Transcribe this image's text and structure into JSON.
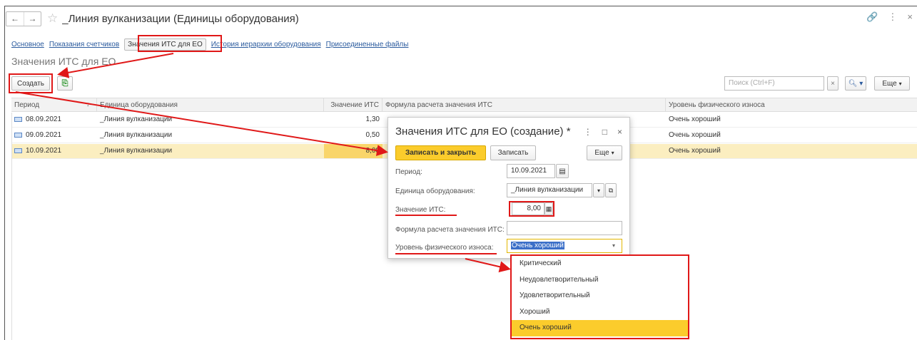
{
  "window": {
    "title": "_Линия вулканизации (Единицы оборудования)",
    "nav_back": "←",
    "nav_forward": "→"
  },
  "tabs": [
    {
      "label": "Основное"
    },
    {
      "label": "Показания счетчиков"
    },
    {
      "label": "Значения ИТС для ЕО",
      "active": true
    },
    {
      "label": "История иерархии оборудования"
    },
    {
      "label": "Присоединенные файлы"
    }
  ],
  "section_title": "Значения ИТС для ЕО",
  "toolbar": {
    "create_label": "Создать",
    "search_placeholder": "Поиск (Ctrl+F)",
    "more_label": "Еще"
  },
  "table": {
    "columns": [
      "Период",
      "Единица оборудования",
      "Значение ИТС",
      "Формула расчета значения ИТС",
      "Уровень физического износа"
    ],
    "rows": [
      {
        "period": "08.09.2021",
        "unit": "_Линия вулканизации",
        "value": "1,30",
        "formula": "",
        "wear": "Очень хороший"
      },
      {
        "period": "09.09.2021",
        "unit": "_Линия вулканизации",
        "value": "0,50",
        "formula": "",
        "wear": "Очень хороший"
      },
      {
        "period": "10.09.2021",
        "unit": "_Линия вулканизации",
        "value": "8,00",
        "formula": "",
        "wear": "Очень хороший",
        "selected": true
      }
    ]
  },
  "dialog": {
    "title": "Значения ИТС для ЕО (создание) *",
    "save_close_label": "Записать и закрыть",
    "save_label": "Записать",
    "more_label": "Еще",
    "fields": {
      "period_label": "Период:",
      "period_value": "10.09.2021",
      "unit_label": "Единица оборудования:",
      "unit_value": "_Линия вулканизации",
      "value_label": "Значение ИТС:",
      "value_value": "8,00",
      "formula_label": "Формула расчета значения ИТС:",
      "formula_value": "",
      "wear_label": "Уровень физического износа:",
      "wear_value": "Очень хороший"
    }
  },
  "dropdown": {
    "options": [
      "Критический",
      "Неудовлетворительный",
      "Удовлетворительный",
      "Хороший",
      "Очень хороший"
    ],
    "selected": "Очень хороший"
  },
  "colors": {
    "accent_yellow": "#fbcc2c",
    "selected_row": "#fbeec0",
    "annotation_red": "#e01818",
    "link_blue": "#2b5b9e"
  }
}
